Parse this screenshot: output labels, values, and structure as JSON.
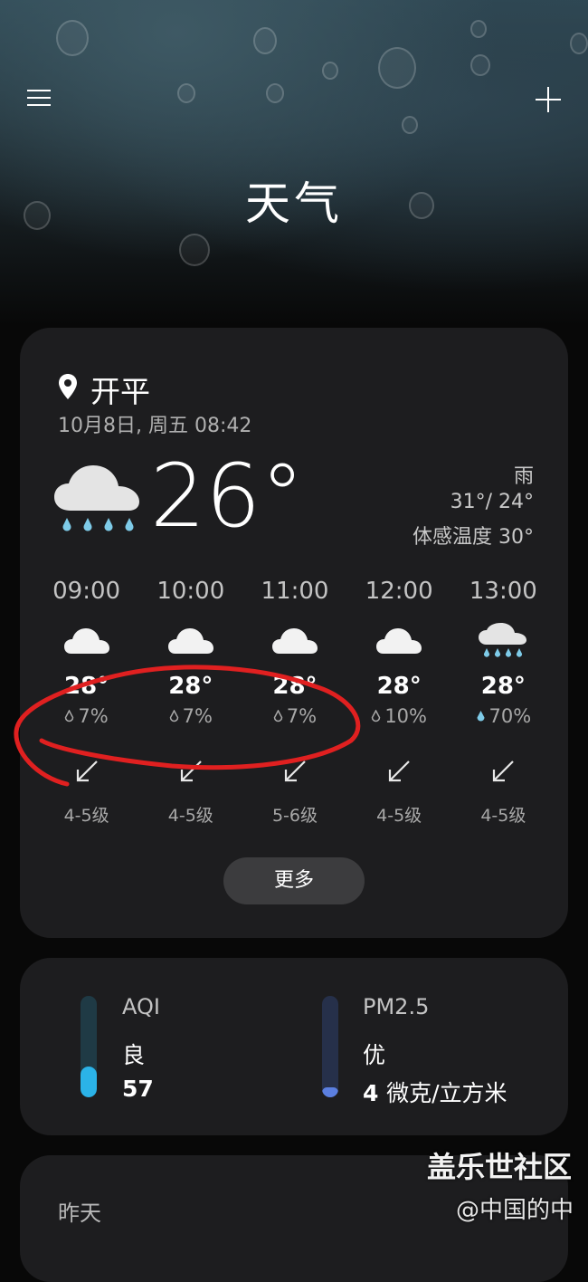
{
  "app_title": "天气",
  "location": {
    "name": "开平",
    "datetime": "10月8日, 周五 08:42"
  },
  "current": {
    "temp": "26°",
    "condition": "雨",
    "high_low": "31°/ 24°",
    "feels_like": "体感温度 30°"
  },
  "hourly": [
    {
      "time": "09:00",
      "icon": "cloud-icon",
      "temp": "28°",
      "precip": "7%",
      "wind_level": "4-5级"
    },
    {
      "time": "10:00",
      "icon": "cloud-icon",
      "temp": "28°",
      "precip": "7%",
      "wind_level": "4-5级"
    },
    {
      "time": "11:00",
      "icon": "cloud-icon",
      "temp": "28°",
      "precip": "7%",
      "wind_level": "5-6级"
    },
    {
      "time": "12:00",
      "icon": "cloud-icon",
      "temp": "28°",
      "precip": "10%",
      "wind_level": "4-5级"
    },
    {
      "time": "13:00",
      "icon": "rain-cloud-icon",
      "temp": "28°",
      "precip": "70%",
      "wind_level": "4-5级"
    }
  ],
  "more_label": "更多",
  "air": {
    "aqi": {
      "label": "AQI",
      "level": "良",
      "value": "57",
      "fill": 0.3,
      "color": "#2bb3e8"
    },
    "pm25": {
      "label": "PM2.5",
      "level": "优",
      "value": "4",
      "unit": "微克/立方米",
      "fill": 0.1,
      "color": "#5b7fe0"
    }
  },
  "yesterday_title": "昨天",
  "watermark": {
    "line1": "盖乐世社区",
    "line2": "@中国的中"
  },
  "colors": {
    "card": "#1d1d1f",
    "annotation": "#e02020",
    "drop_high": "#7ecbe8"
  }
}
